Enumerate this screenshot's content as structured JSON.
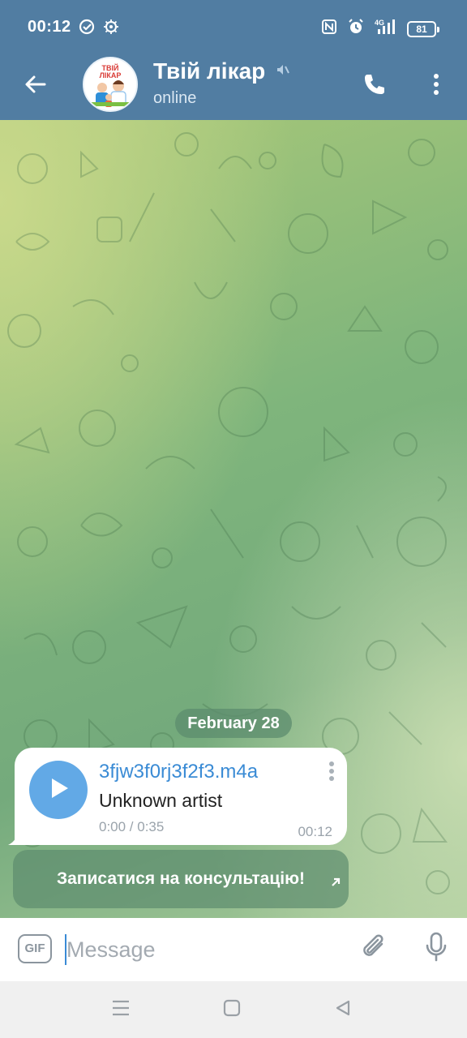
{
  "status_bar": {
    "time": "00:12",
    "battery": "81",
    "icons": [
      "check-circle-icon",
      "virus-icon",
      "nfc-icon",
      "alarm-icon",
      "signal-4g-icon",
      "battery-icon"
    ]
  },
  "header": {
    "back_icon": "arrow-left-icon",
    "avatar": {
      "label": "ТВІЙ ЛІКАР",
      "icon": "doctor-avatar"
    },
    "title": "Твій лікар",
    "muted_icon": "muted-icon",
    "status": "online",
    "call_icon": "phone-icon",
    "menu_icon": "more-vertical-icon"
  },
  "chat": {
    "date_separator": "February 28",
    "messages": [
      {
        "type": "audio",
        "file_name": "3fjw3f0rj3f2f3.m4a",
        "artist": "Unknown artist",
        "duration": "0:00 / 0:35",
        "time": "00:12",
        "play_icon": "play-icon",
        "menu_icon": "more-vertical-icon"
      }
    ],
    "inline_button": {
      "label": "Записатися на консультацію!",
      "icon": "arrow-up-right-icon"
    }
  },
  "input": {
    "gif_label": "GIF",
    "placeholder": "Message",
    "value": "",
    "attach_icon": "paperclip-icon",
    "mic_icon": "microphone-icon"
  },
  "nav": {
    "icons": [
      "menu-icon",
      "home-square-icon",
      "back-triangle-icon"
    ]
  },
  "colors": {
    "header": "#517da2",
    "accent": "#3a8bd5",
    "play_button": "#62a9e6",
    "input_bar": "#ffffff",
    "nav_bar": "#f0f0f0"
  }
}
